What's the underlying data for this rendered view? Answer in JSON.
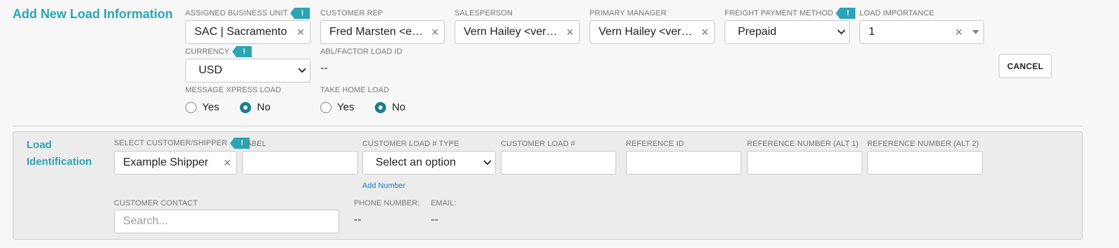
{
  "header": {
    "title": "Add New Load Information"
  },
  "top_fields": {
    "business_unit": {
      "label": "ASSIGNED BUSINESS UNIT",
      "value": "SAC | Sacramento"
    },
    "customer_rep": {
      "label": "CUSTOMER REP",
      "value": "Fred Marsten <example.rep@example.com>"
    },
    "salesperson": {
      "label": "SALESPERSON",
      "value": "Vern Hailey <vern.hailey@example.com>"
    },
    "primary_manager": {
      "label": "PRIMARY MANAGER",
      "value": "Vern Hailey <vern.hailey@example.com>"
    },
    "freight_payment": {
      "label": "FREIGHT PAYMENT METHOD",
      "value": "Prepaid"
    },
    "load_importance": {
      "label": "LOAD IMPORTANCE",
      "value": "1"
    },
    "currency": {
      "label": "CURRENCY",
      "value": "USD"
    },
    "abl_factor": {
      "label": "ABL/FACTOR LOAD ID",
      "value": "--"
    },
    "message_xpress": {
      "label": "MESSAGE XPRESS LOAD",
      "yes": "Yes",
      "no": "No",
      "selected": "No"
    },
    "take_home": {
      "label": "TAKE HOME LOAD",
      "yes": "Yes",
      "no": "No",
      "selected": "No"
    },
    "flag_icon_text": "!"
  },
  "actions": {
    "cancel_label": "CANCEL"
  },
  "load_identification": {
    "title_line1": "Load",
    "title_line2": "Identification",
    "customer_shipper": {
      "label": "SELECT CUSTOMER/SHIPPER",
      "value": "Example Shipper"
    },
    "label_field": {
      "label": "LABEL",
      "value": ""
    },
    "customer_load_type": {
      "label": "CUSTOMER LOAD # TYPE",
      "value": "Select an option"
    },
    "add_number_link": "Add Number",
    "customer_load_num": {
      "label": "CUSTOMER LOAD #",
      "value": ""
    },
    "reference_id": {
      "label": "REFERENCE ID",
      "value": ""
    },
    "reference_alt1": {
      "label": "REFERENCE NUMBER (ALT 1)",
      "value": ""
    },
    "reference_alt2": {
      "label": "REFERENCE NUMBER (ALT 2)",
      "value": ""
    },
    "customer_contact": {
      "label": "CUSTOMER CONTACT",
      "placeholder": "Search..."
    },
    "phone": {
      "label": "PHONE NUMBER:",
      "value": "--"
    },
    "email": {
      "label": "EMAIL:",
      "value": "--"
    }
  },
  "colors": {
    "accent": "#2aa5b5",
    "radio_selected": "#1a7f8c",
    "link": "#1a7fc1"
  }
}
